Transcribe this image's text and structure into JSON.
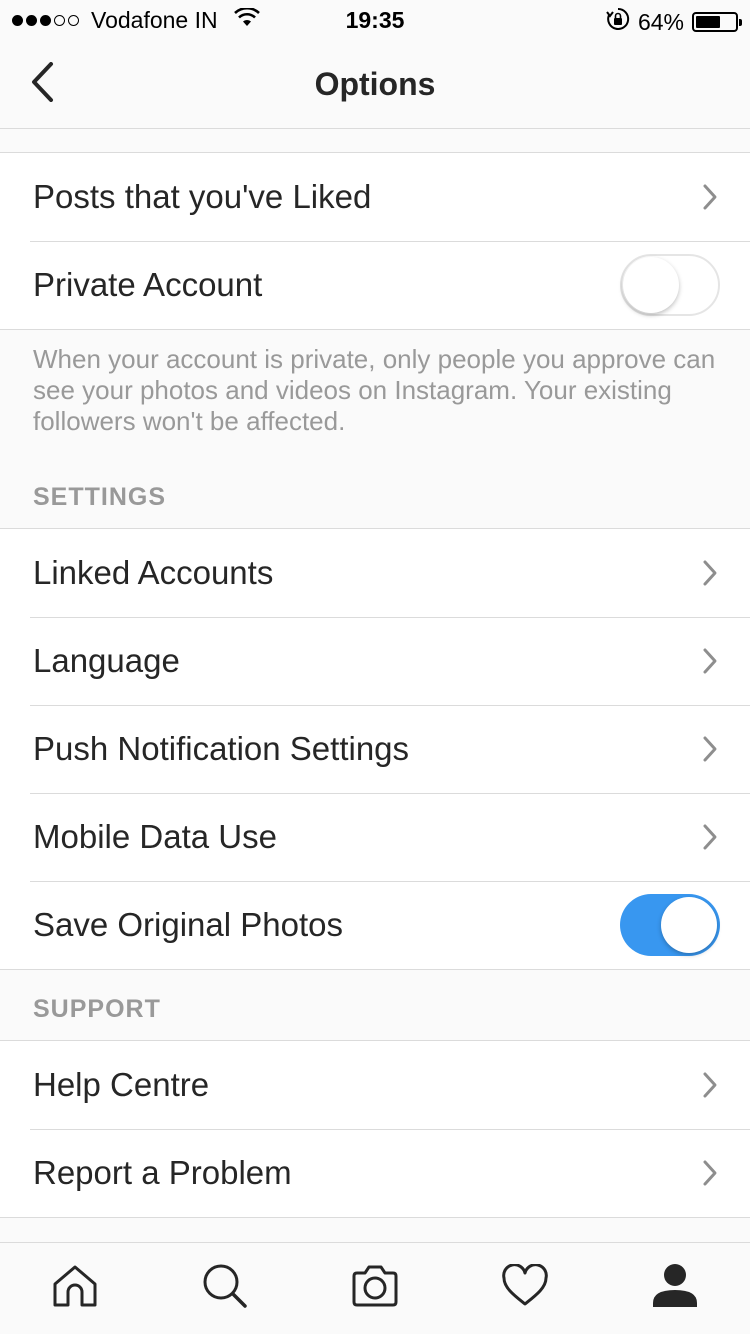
{
  "status_bar": {
    "carrier": "Vodafone IN",
    "time": "19:35",
    "battery_percent": "64%",
    "battery_level": 0.64,
    "signal_bars_filled": 3,
    "signal_bars_total": 5
  },
  "nav": {
    "title": "Options",
    "back_icon": "chevron-left-icon"
  },
  "account_section": {
    "rows": [
      {
        "label": "Posts that you've Liked",
        "type": "link"
      },
      {
        "label": "Private Account",
        "type": "toggle",
        "on": false
      }
    ],
    "help_text": "When your account is private, only people you approve can see your photos and videos on Instagram. Your existing followers won't be affected."
  },
  "settings_section": {
    "header": "SETTINGS",
    "rows": [
      {
        "label": "Linked Accounts",
        "type": "link"
      },
      {
        "label": "Language",
        "type": "link"
      },
      {
        "label": "Push Notification Settings",
        "type": "link"
      },
      {
        "label": "Mobile Data Use",
        "type": "link"
      },
      {
        "label": "Save Original Photos",
        "type": "toggle",
        "on": true
      }
    ]
  },
  "support_section": {
    "header": "SUPPORT",
    "rows": [
      {
        "label": "Help Centre",
        "type": "link"
      },
      {
        "label": "Report a Problem",
        "type": "link"
      }
    ]
  },
  "tab_bar": {
    "tabs": [
      {
        "icon": "home-icon"
      },
      {
        "icon": "search-icon"
      },
      {
        "icon": "camera-icon"
      },
      {
        "icon": "heart-icon"
      },
      {
        "icon": "profile-icon",
        "active": true
      }
    ]
  },
  "colors": {
    "accent": "#3897f0",
    "text_primary": "#262626",
    "text_secondary": "#999999",
    "separator": "#dbdbdb",
    "background": "#fafafa"
  }
}
